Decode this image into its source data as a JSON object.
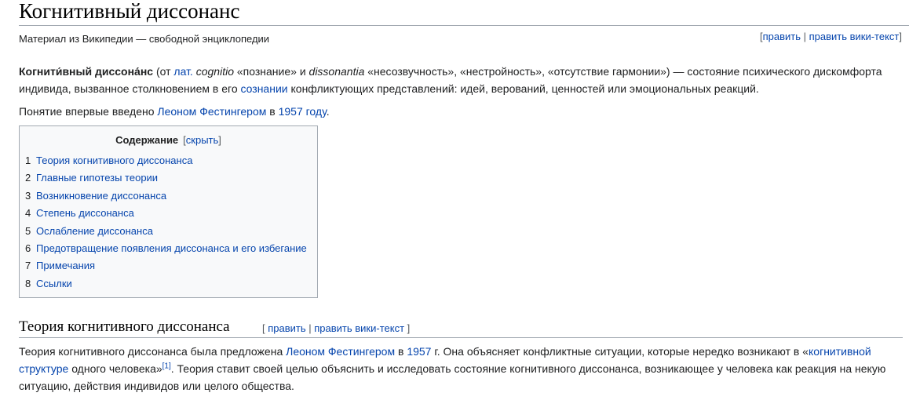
{
  "article": {
    "title": "Когнитивный диссонанс",
    "tagline": "Материал из Википедии — свободной энциклопедии"
  },
  "edit_links": {
    "open": "[",
    "edit": "править",
    "sep": " | ",
    "edit_source": "править вики-текст",
    "close": "]"
  },
  "intro": {
    "term": "Когнити́вный диссона́нс",
    "t1": " (от ",
    "lat_link": "лат.",
    "t2": " ",
    "cognitio": "cognitio",
    "t3": " «познание» и ",
    "dissonantia": "dissonantia",
    "t4": " «несозвучность», «нестройность», «отсутствие гармонии») — состояние психического дискомфорта индивида, вызванное столкновением в его ",
    "consciousness_link": "сознании",
    "t5": " конфликтующих представлений: идей, верований, ценностей или эмоциональных реакций."
  },
  "intro2": {
    "t1": "Понятие впервые введено ",
    "festinger_link": "Леоном Фестингером",
    "t2": " в ",
    "year_link": "1957 году",
    "t3": "."
  },
  "toc": {
    "title": "Содержание",
    "hide_open": "[",
    "hide_label": "скрыть",
    "hide_close": "]",
    "items": [
      {
        "num": "1",
        "label": "Теория когнитивного диссонанса"
      },
      {
        "num": "2",
        "label": "Главные гипотезы теории"
      },
      {
        "num": "3",
        "label": "Возникновение диссонанса"
      },
      {
        "num": "4",
        "label": "Степень диссонанса"
      },
      {
        "num": "5",
        "label": "Ослабление диссонанса"
      },
      {
        "num": "6",
        "label": "Предотвращение появления диссонанса и его избегание"
      },
      {
        "num": "7",
        "label": "Примечания"
      },
      {
        "num": "8",
        "label": "Ссылки"
      }
    ]
  },
  "section1": {
    "heading": "Теория когнитивного диссонанса",
    "edit_open": "[ ",
    "edit": "править",
    "sep": " | ",
    "edit_source": "править вики-текст",
    "edit_close": " ]",
    "t1": "Теория когнитивного диссонанса была предложена ",
    "festinger_link": "Леоном Фестингером",
    "t2": " в ",
    "year_link": "1957",
    "t3": " г. Она объясняет конфликтные ситуации, которые нередко возникают в «",
    "structure_link": "когнитивной структуре",
    "t4": " одного человека»",
    "ref": "[1]",
    "t5": ". Теория ставит своей целью объяснить и исследовать состояние когнитивного диссонанса, возникающее у человека как реакция на некую ситуацию, действия индивидов или целого общества."
  }
}
